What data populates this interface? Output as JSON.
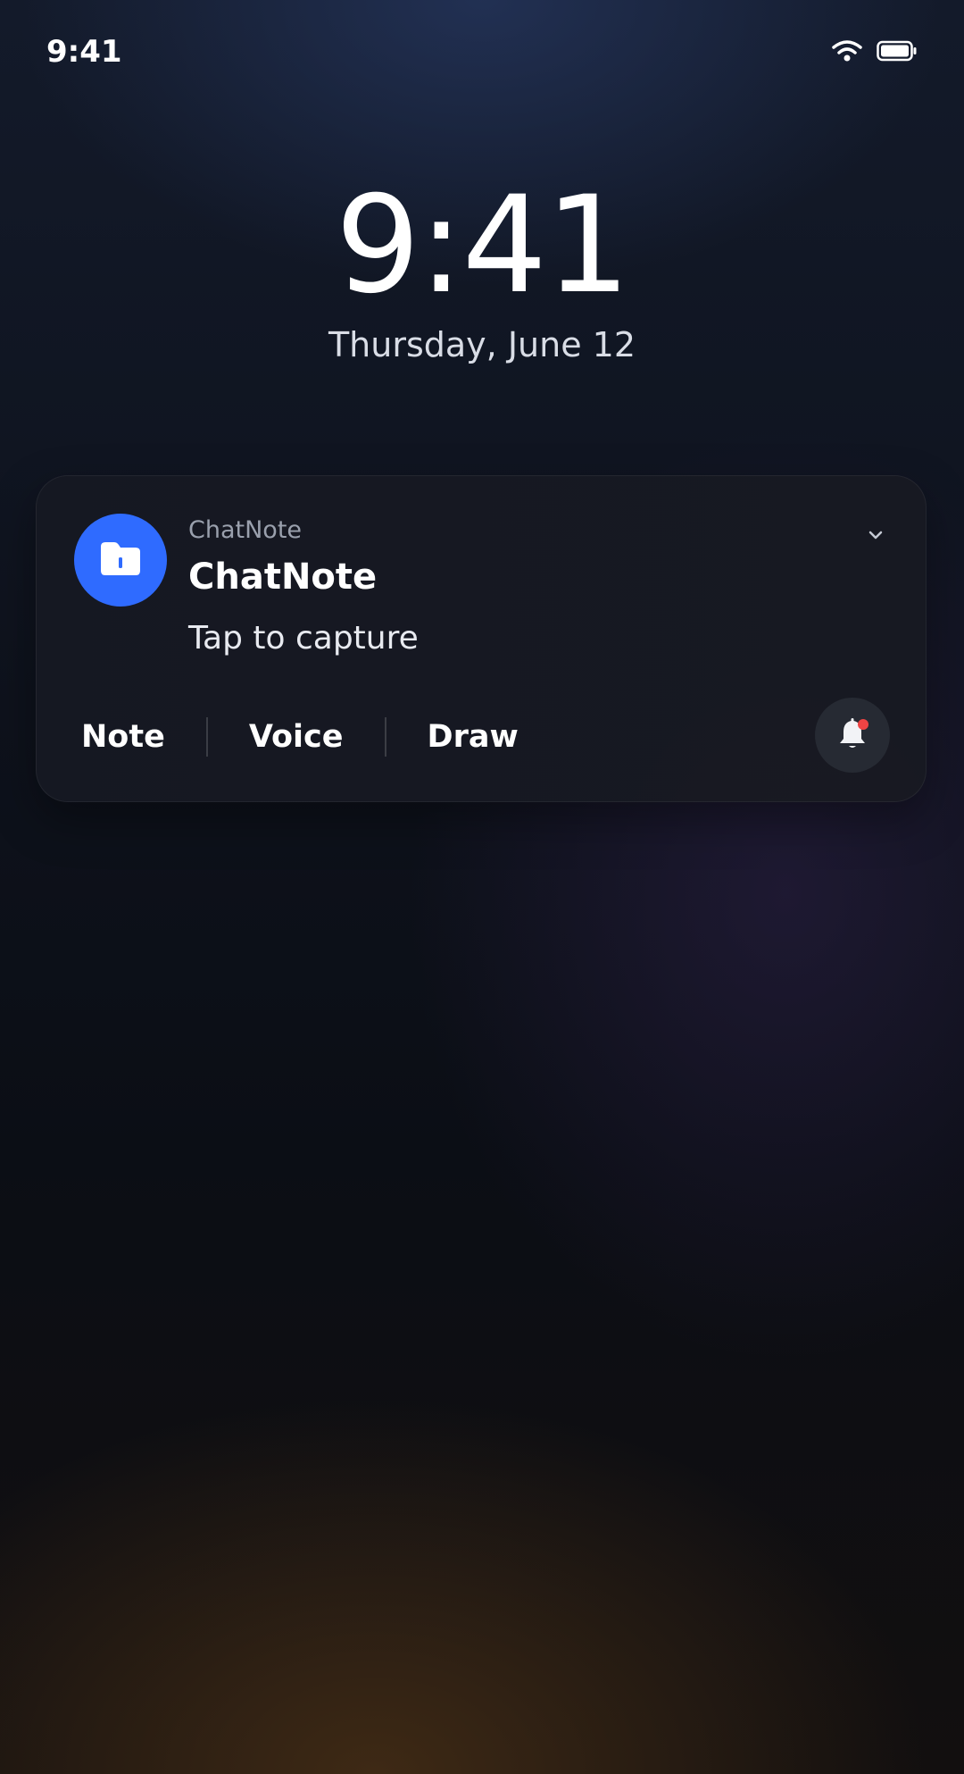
{
  "status_bar": {
    "time": "9:41",
    "icons": [
      "wifi-icon",
      "battery-icon"
    ]
  },
  "lock_screen": {
    "time": "9:41",
    "date": "Thursday, June 12"
  },
  "notification": {
    "app_name": "ChatNote",
    "title": "ChatNote",
    "body": "Tap to capture",
    "icon": "folder-icon",
    "icon_color": "#2f6bff",
    "actions": [
      {
        "label": "Note"
      },
      {
        "label": "Voice"
      },
      {
        "label": "Draw"
      }
    ],
    "bell_icon": "bell-icon",
    "badge_color": "#ef4444"
  }
}
